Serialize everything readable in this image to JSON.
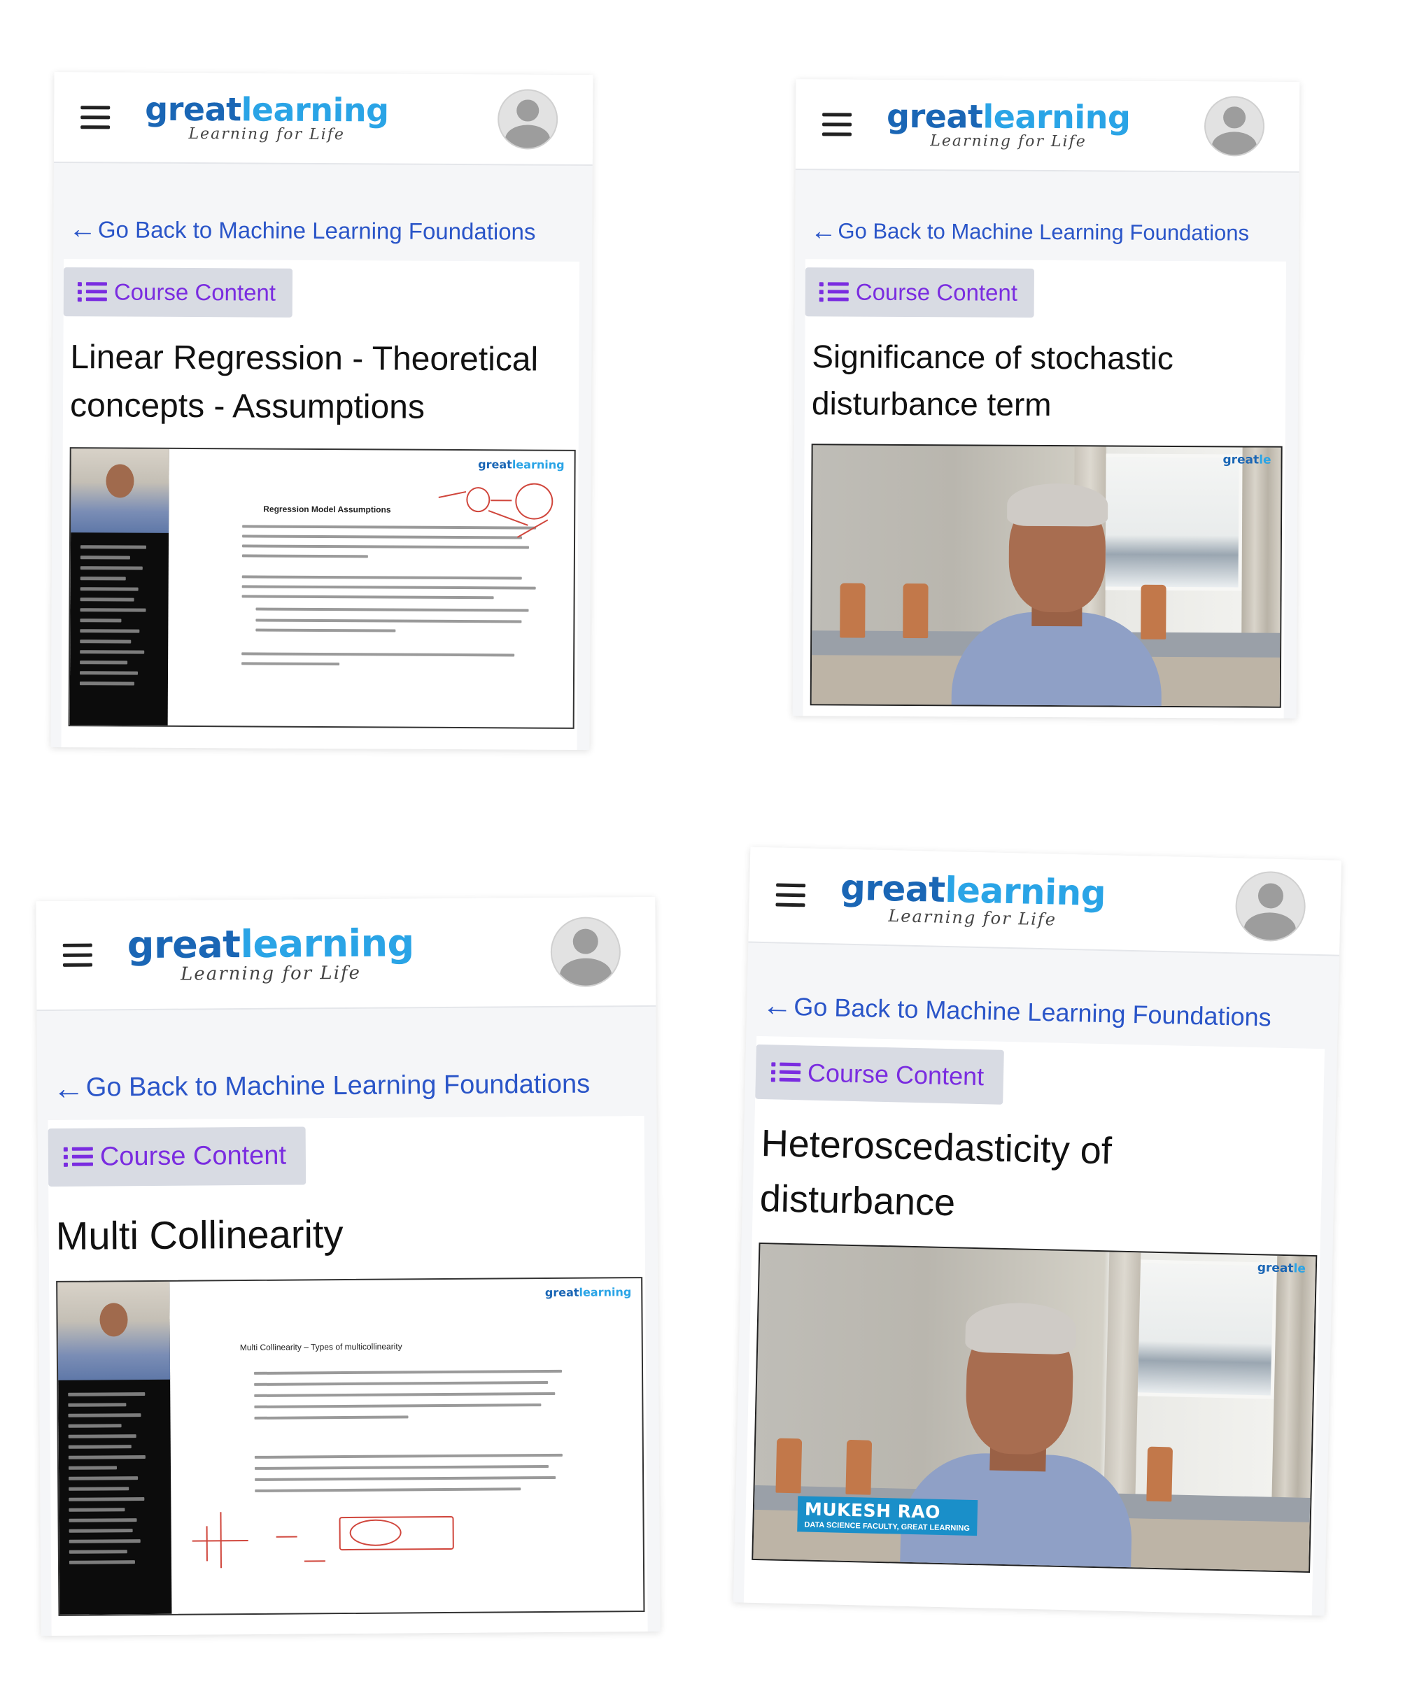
{
  "brand": {
    "word_part1": "great",
    "word_part2": "learning",
    "tagline": "Learning for Life"
  },
  "back_link_label": "Go Back to Machine Learning Foundations",
  "course_content_label": "Course Content",
  "screens": [
    {
      "lesson_title": "Linear Regression - Theoretical concepts - Assumptions",
      "video": {
        "kind": "slide",
        "slide_heading": "Regression Model Assumptions",
        "slide_logo_1": "great",
        "slide_logo_2": "learning"
      }
    },
    {
      "lesson_title": "Significance of stochastic disturbance term",
      "video": {
        "kind": "camera",
        "cam_logo_1": "great",
        "cam_logo_2": "le"
      }
    },
    {
      "lesson_title": "Multi Collinearity",
      "video": {
        "kind": "slide",
        "slide_heading": "Multi Collinearity – Types of multicollinearity",
        "slide_logo_1": "great",
        "slide_logo_2": "learning"
      }
    },
    {
      "lesson_title": "Heteroscedasticity of disturbance",
      "video": {
        "kind": "camera",
        "cam_logo_1": "great",
        "cam_logo_2": "le",
        "presenter_name": "MUKESH RAO",
        "presenter_role": "DATA SCIENCE FACULTY, GREAT LEARNING"
      }
    }
  ],
  "colors": {
    "brand_dark_blue": "#1a66b5",
    "brand_light_blue": "#2aa4e6",
    "link_blue": "#2a55c8",
    "course_content_purple": "#7a2ce0",
    "course_content_bg": "#d8dbe3",
    "lower_third_blue": "#1a8fc9"
  },
  "icons": {
    "menu": "hamburger-menu-icon",
    "avatar": "user-avatar-icon",
    "back": "arrow-left-icon",
    "course_content": "list-icon"
  }
}
